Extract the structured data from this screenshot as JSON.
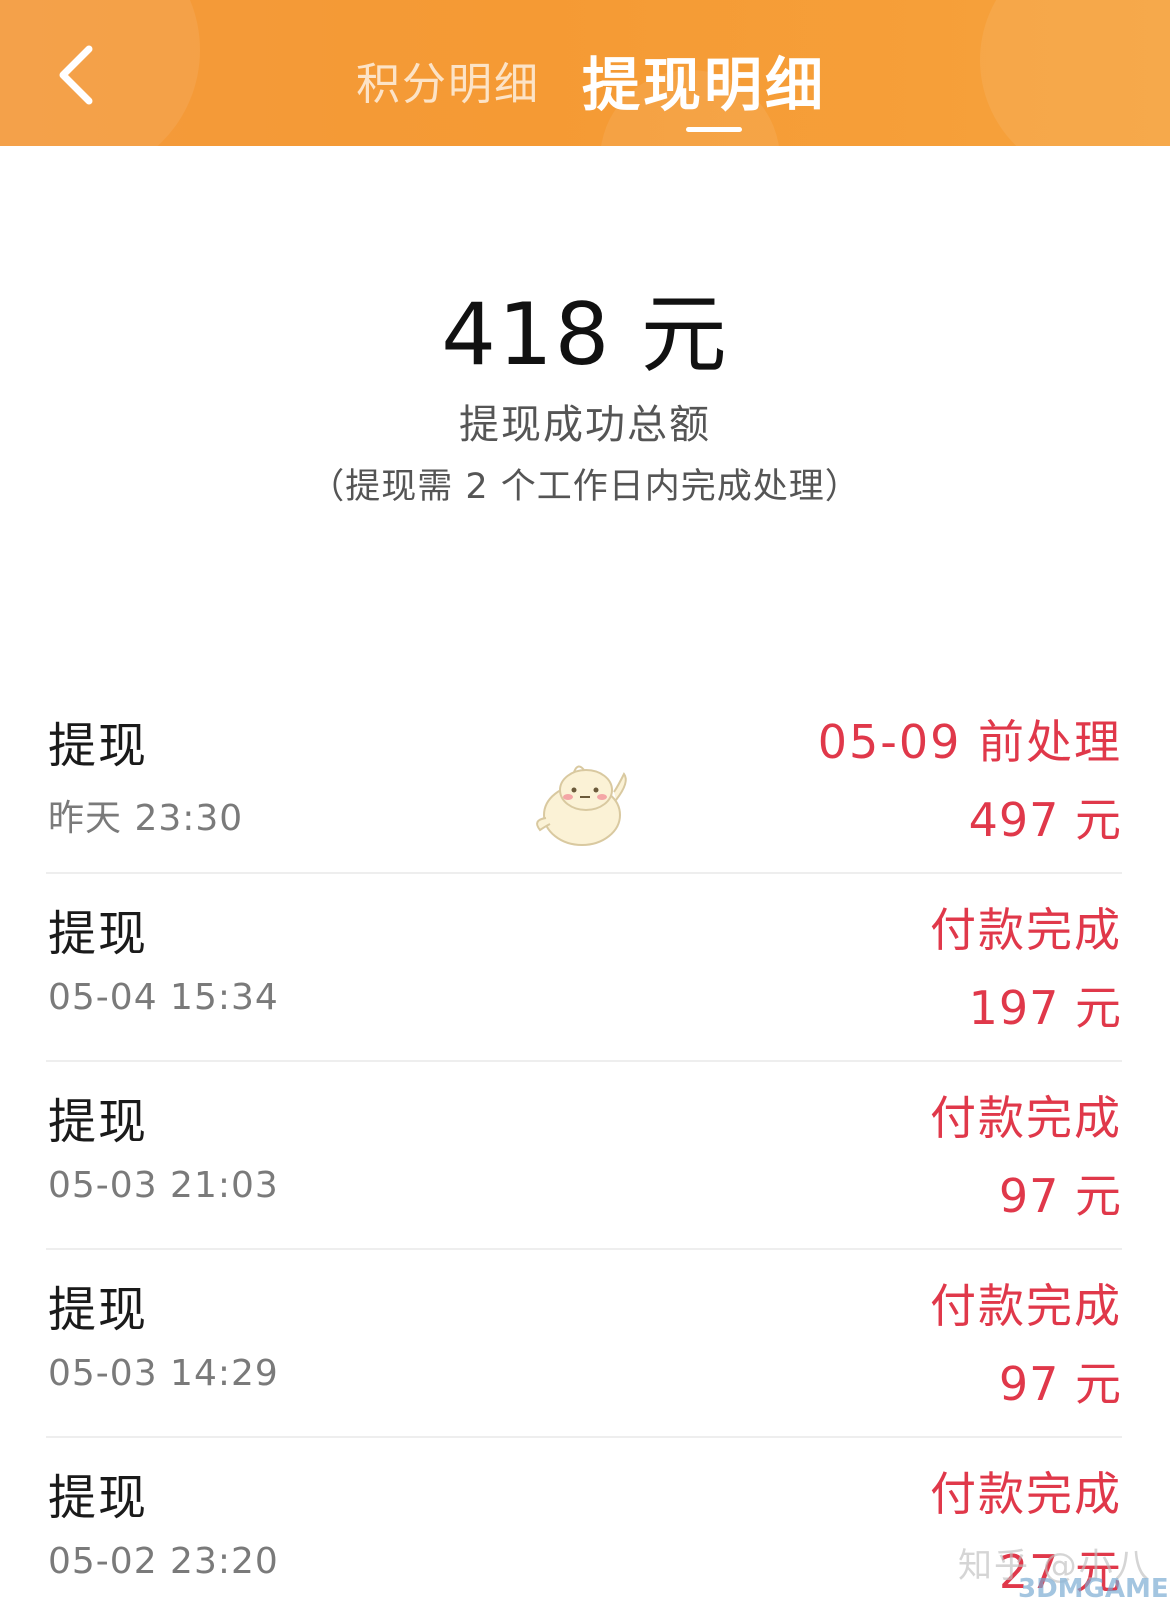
{
  "header": {
    "tabs": [
      {
        "label": "积分明细",
        "active": false
      },
      {
        "label": "提现明细",
        "active": true
      }
    ],
    "background_color": "#f59a34"
  },
  "summary": {
    "total_amount": "418 元",
    "total_label": "提现成功总额",
    "note": "（提现需 2 个工作日内完成处理）"
  },
  "records": [
    {
      "type": "提现",
      "time": "昨天 23:30",
      "status": "05-09 前处理",
      "amount": "497 元"
    },
    {
      "type": "提现",
      "time": "05-04 15:34",
      "status": "付款完成",
      "amount": "197 元"
    },
    {
      "type": "提现",
      "time": "05-03 21:03",
      "status": "付款完成",
      "amount": "97 元"
    },
    {
      "type": "提现",
      "time": "05-03 14:29",
      "status": "付款完成",
      "amount": "97 元"
    },
    {
      "type": "提现",
      "time": "05-02 23:20",
      "status": "付款完成",
      "amount": "27 元"
    }
  ],
  "colors": {
    "accent_red": "#e0384a",
    "header_orange": "#f59a34"
  },
  "icons": {
    "back": "chevron-left-icon",
    "mascot": "chick-mascot-icon"
  },
  "watermark": {
    "text": "知乎 @小八",
    "logo": "3DMGAME"
  }
}
